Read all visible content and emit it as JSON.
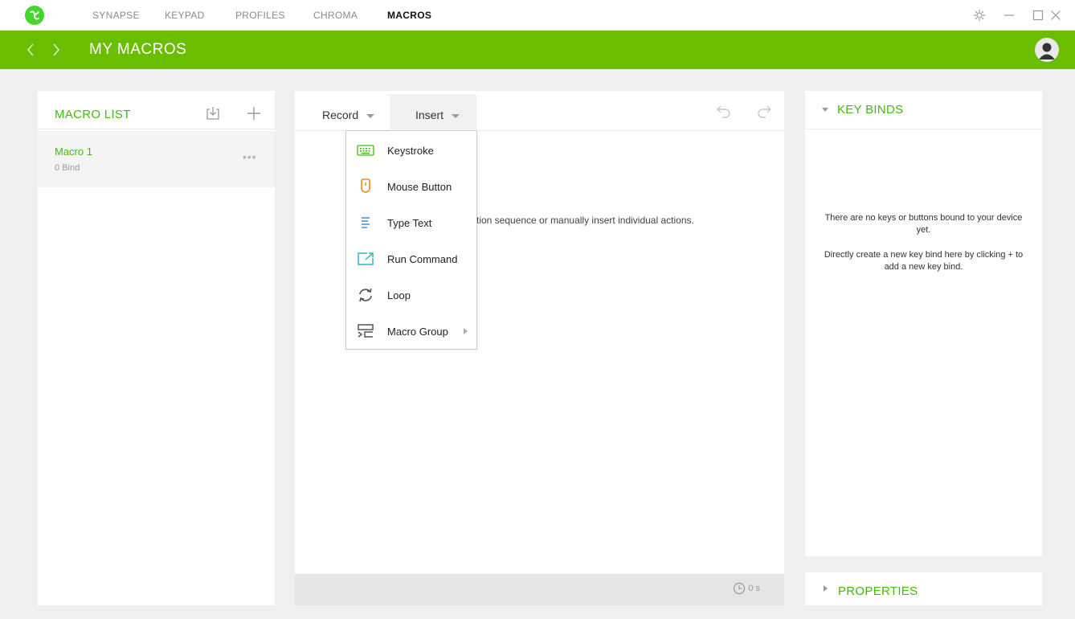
{
  "nav": {
    "tabs": [
      {
        "label": "SYNAPSE"
      },
      {
        "label": "KEYPAD"
      },
      {
        "label": "PROFILES"
      },
      {
        "label": "CHROMA"
      },
      {
        "label": "MACROS"
      }
    ],
    "active_tab": "MACROS",
    "window_controls": [
      "settings-icon",
      "minimize-icon",
      "maximize-icon",
      "close-icon"
    ]
  },
  "header": {
    "title": "MY MACROS",
    "icons": [
      "back-arrow-icon",
      "forward-arrow-icon",
      "user-avatar-icon"
    ]
  },
  "macro_list": {
    "title": "MACRO LIST",
    "actions": [
      "import-icon",
      "add-icon"
    ],
    "items": [
      {
        "name": "Macro 1",
        "sub": "0 Bind",
        "more": "•••"
      }
    ]
  },
  "editor": {
    "record_label": "Record",
    "insert_label": "Insert",
    "hint": "tion sequence or manually insert individual actions.",
    "timer_value": "0 s"
  },
  "insert_menu": {
    "items": [
      {
        "label": "Keystroke",
        "icon": "keyboard-icon",
        "color": "#44b90a"
      },
      {
        "label": "Mouse Button",
        "icon": "mouse-icon",
        "color": "#f08a1c"
      },
      {
        "label": "Type Text",
        "icon": "text-lines-icon",
        "color": "#3a8fd9"
      },
      {
        "label": "Run Command",
        "icon": "run-command-icon",
        "color": "#2fb3c6"
      },
      {
        "label": "Loop",
        "icon": "loop-icon",
        "color": "#555555"
      },
      {
        "label": "Macro Group",
        "icon": "macro-group-icon",
        "color": "#555555",
        "has_submenu": true
      }
    ]
  },
  "key_binds": {
    "title": "KEY BINDS",
    "text1": "There are no keys or buttons bound to your device yet.",
    "text2": "Directly create a new key bind here by clicking + to add a new key bind."
  },
  "properties": {
    "title": "PROPERTIES"
  },
  "colors": {
    "accent_green": "#44b90a",
    "header_green": "#6bbd02"
  }
}
